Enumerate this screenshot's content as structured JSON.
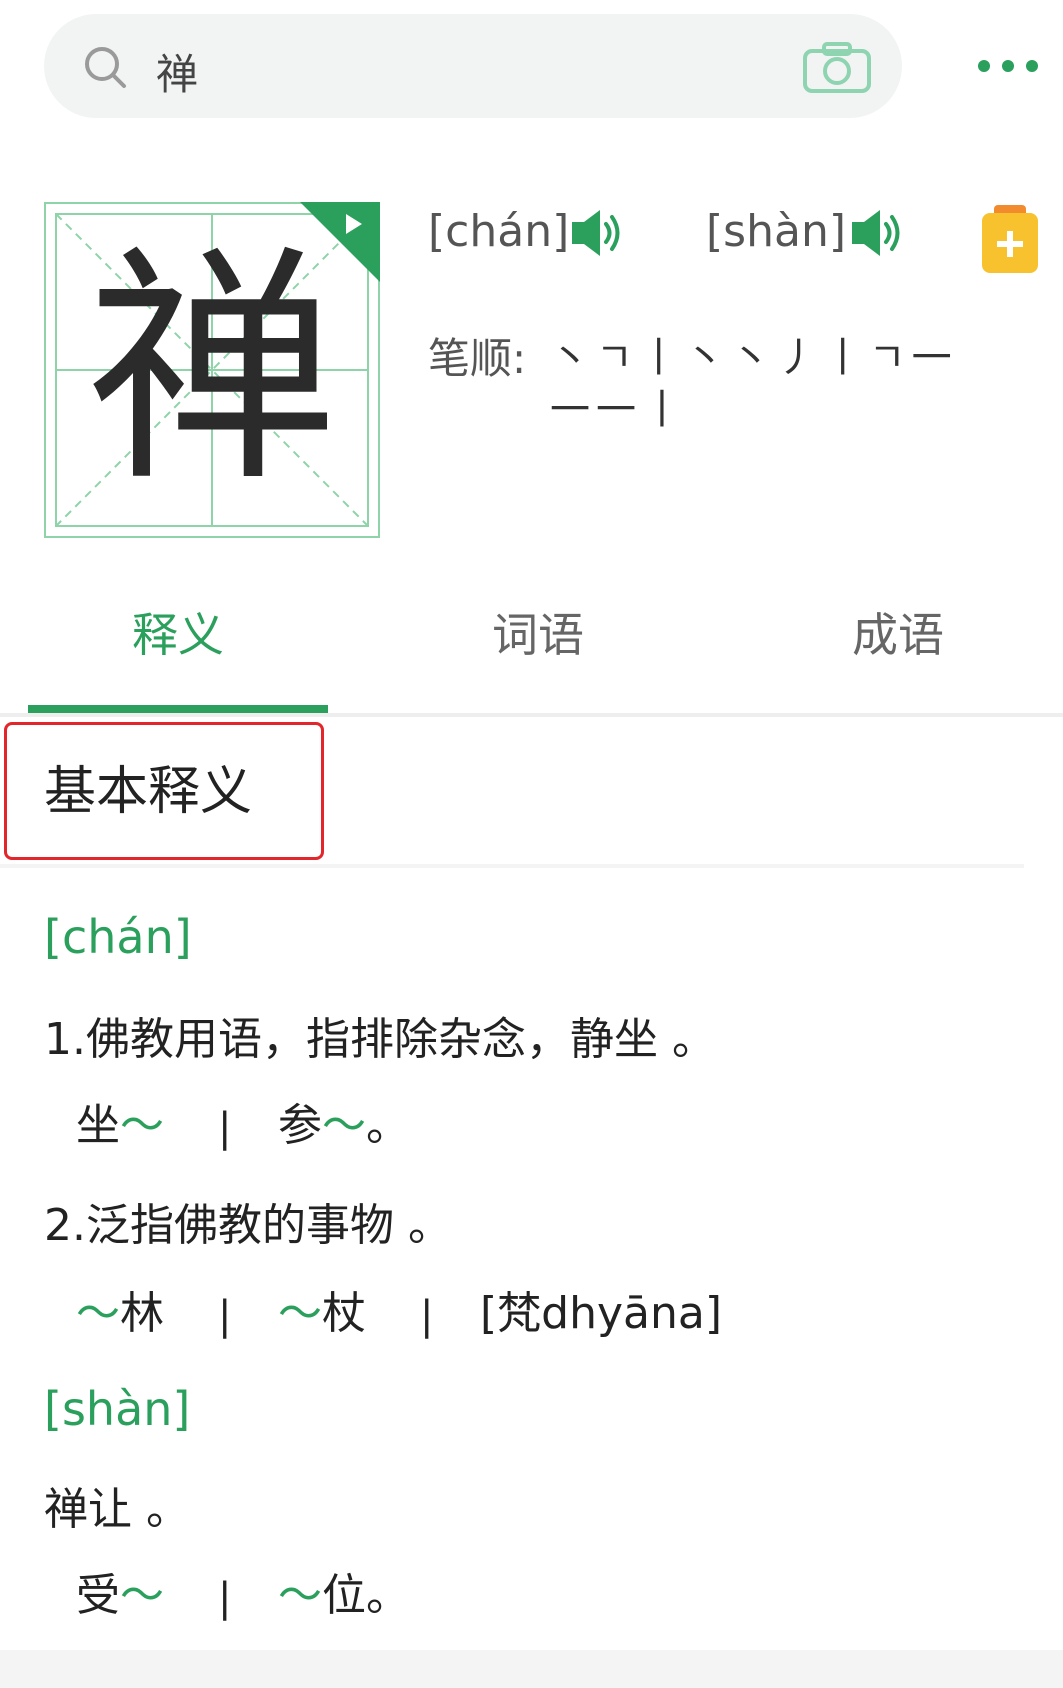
{
  "search": {
    "query": "禅"
  },
  "character": {
    "glyph": "禅"
  },
  "pronunciations": [
    {
      "pinyin": "[chán]"
    },
    {
      "pinyin": "[shàn]"
    }
  ],
  "stroke_order": {
    "label": "笔顺:",
    "line1": "丶ㄱ丨丶丶丿丨ㄱ一",
    "line2": "一一丨"
  },
  "tabs": [
    {
      "label": "释义",
      "active": true
    },
    {
      "label": "词语",
      "active": false
    },
    {
      "label": "成语",
      "active": false
    }
  ],
  "section": {
    "title": "基本释义"
  },
  "definitions": {
    "chan": {
      "pinyin": "[chán]",
      "items": [
        {
          "text": "1.佛教用语，指排除杂念，静坐 。",
          "examples": [
            {
              "pre": "坐",
              "tilde": "～",
              "post": ""
            },
            {
              "pre": "参",
              "tilde": "～",
              "post": "。"
            }
          ]
        },
        {
          "text": "2.泛指佛教的事物 。",
          "examples": [
            {
              "pre": "",
              "tilde": "～",
              "post": "林"
            },
            {
              "pre": "",
              "tilde": "～",
              "post": "杖"
            },
            {
              "pre": "[梵dhyāna]",
              "tilde": "",
              "post": ""
            }
          ]
        }
      ]
    },
    "shan": {
      "pinyin": "[shàn]",
      "items": [
        {
          "text": "禅让 。",
          "examples": [
            {
              "pre": "受",
              "tilde": "～",
              "post": ""
            },
            {
              "pre": "",
              "tilde": "～",
              "post": "位。"
            }
          ]
        }
      ]
    },
    "separator": "|"
  },
  "colors": {
    "accent": "#2aa05c",
    "highlight_border": "#e3262b",
    "add_button": "#f7c22e"
  },
  "icons": [
    "search-icon",
    "camera-icon",
    "more-icon",
    "play-icon",
    "speaker-icon",
    "add-to-notebook-icon"
  ]
}
